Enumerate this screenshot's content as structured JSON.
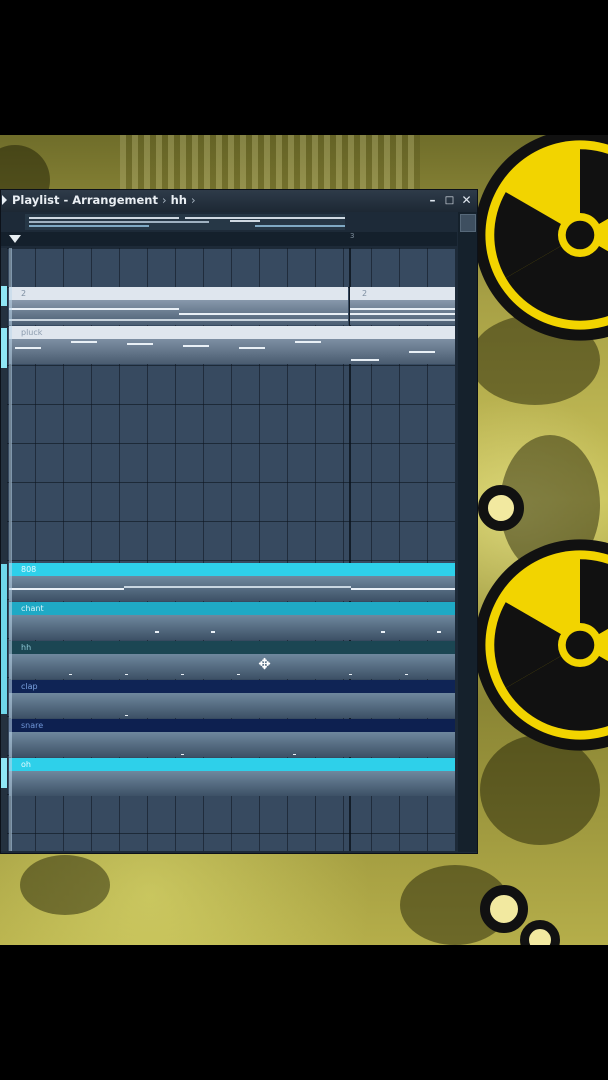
{
  "window": {
    "title": "Playlist - Arrangement",
    "separator": "›",
    "pattern": "hh",
    "pattern_arrow": "›",
    "minimize_label": "–",
    "maximize_label": "□",
    "close_label": "✕"
  },
  "ruler": {
    "bar_markers": [
      "3"
    ]
  },
  "clips": [
    {
      "name": "2",
      "start_label": "2"
    },
    {
      "name": "2",
      "start_label": "2"
    },
    {
      "name": "pluck"
    },
    {
      "name": "808"
    },
    {
      "name": "chant"
    },
    {
      "name": "hh"
    },
    {
      "name": "clap"
    },
    {
      "name": "snare"
    },
    {
      "name": "oh"
    }
  ],
  "icons": [
    "play-arrow-icon",
    "minimize-icon",
    "maximize-icon",
    "close-icon",
    "song-position-marker-icon",
    "move-cursor-icon",
    "radiation-symbol-icon"
  ],
  "colors": {
    "clip_white": "#dfe6ee",
    "clip_cyan_bright": "#2ed0ea",
    "clip_cyan": "#1fa9c5",
    "clip_teal_dark": "#1b4653",
    "clip_navy": "#0f2455",
    "clip_navy_dark": "#0d2050",
    "grid": "#374a60",
    "radiation_yellow": "#f2d400"
  }
}
